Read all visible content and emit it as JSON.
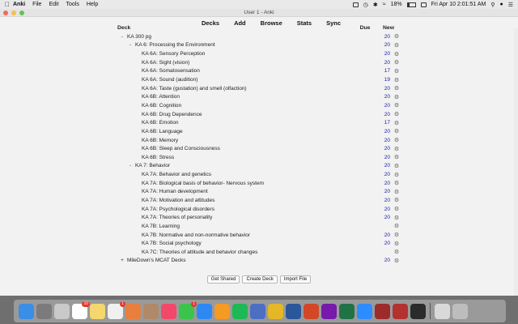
{
  "menubar": {
    "app_name": "Anki",
    "items": [
      "File",
      "Edit",
      "Tools",
      "Help"
    ],
    "battery": "18%",
    "clock": "Fri Apr 10  2:01:51 AM"
  },
  "window": {
    "title": "User 1 - Anki"
  },
  "toolbar": {
    "decks": "Decks",
    "add": "Add",
    "browse": "Browse",
    "stats": "Stats",
    "sync": "Sync"
  },
  "deck_list": {
    "headers": {
      "deck": "Deck",
      "due": "Due",
      "new": "New"
    },
    "rows": [
      {
        "level": 0,
        "expander": "-",
        "name": "KA 300 pg",
        "new": "20"
      },
      {
        "level": 1,
        "expander": "-",
        "name": "KA 6: Processing the Environment",
        "new": "20"
      },
      {
        "level": 2,
        "expander": "",
        "name": "KA 6A: Sensory Perception",
        "new": "20"
      },
      {
        "level": 2,
        "expander": "",
        "name": "KA 6A: Sight (vision)",
        "new": "20"
      },
      {
        "level": 2,
        "expander": "",
        "name": "KA 6A: Somatosensation",
        "new": "17"
      },
      {
        "level": 2,
        "expander": "",
        "name": "KA 6A: Sound (audition)",
        "new": "19"
      },
      {
        "level": 2,
        "expander": "",
        "name": "KA 6A: Taste (gustation) and smell (olfaction)",
        "new": "20"
      },
      {
        "level": 2,
        "expander": "",
        "name": "KA 6B: Attention",
        "new": "20"
      },
      {
        "level": 2,
        "expander": "",
        "name": "KA 6B: Cognition",
        "new": "20"
      },
      {
        "level": 2,
        "expander": "",
        "name": "KA 6B: Drug Dependence",
        "new": "20"
      },
      {
        "level": 2,
        "expander": "",
        "name": "KA 6B: Emotion",
        "new": "17"
      },
      {
        "level": 2,
        "expander": "",
        "name": "KA 6B: Language",
        "new": "20"
      },
      {
        "level": 2,
        "expander": "",
        "name": "KA 6B: Memory",
        "new": "20"
      },
      {
        "level": 2,
        "expander": "",
        "name": "KA 6B: Sleep and Consciousness",
        "new": "20"
      },
      {
        "level": 2,
        "expander": "",
        "name": "KA 6B: Stress",
        "new": "20"
      },
      {
        "level": 1,
        "expander": "-",
        "name": "KA 7: Behavior",
        "new": "20"
      },
      {
        "level": 2,
        "expander": "",
        "name": "KA 7A: Behavior and genetics",
        "new": "20"
      },
      {
        "level": 2,
        "expander": "",
        "name": "KA 7A: Biological basis of behavior- Nervous system",
        "new": "20"
      },
      {
        "level": 2,
        "expander": "",
        "name": "KA 7A: Human development",
        "new": "20"
      },
      {
        "level": 2,
        "expander": "",
        "name": "KA 7A: Motivation and attitudes",
        "new": "20"
      },
      {
        "level": 2,
        "expander": "",
        "name": "KA 7A: Psychological disorders",
        "new": "20"
      },
      {
        "level": 2,
        "expander": "",
        "name": "KA 7A: Theories of personality",
        "new": "20"
      },
      {
        "level": 2,
        "expander": "",
        "name": "KA 7B: Learning",
        "new": ""
      },
      {
        "level": 2,
        "expander": "",
        "name": "KA 7B: Normative and non-normative behavior",
        "new": "20"
      },
      {
        "level": 2,
        "expander": "",
        "name": "KA 7B: Social psychology",
        "new": "20"
      },
      {
        "level": 2,
        "expander": "",
        "name": "KA 7C: Theories of attitude and behavior changes",
        "new": ""
      },
      {
        "level": 0,
        "expander": "+",
        "name": "MileDown's MCAT Decks",
        "new": "20"
      }
    ]
  },
  "bottom_buttons": {
    "get_shared": "Get Shared",
    "create_deck": "Create Deck",
    "import_file": "Import File"
  },
  "dock": {
    "apps": [
      {
        "name": "finder-icon",
        "color": "#3a8ee6"
      },
      {
        "name": "system-preferences-icon",
        "color": "#7b7b7b"
      },
      {
        "name": "launchpad-icon",
        "color": "#c9c9c9"
      },
      {
        "name": "calendar-icon",
        "color": "#ffffff",
        "badge": "10"
      },
      {
        "name": "notes-icon",
        "color": "#f5d76e"
      },
      {
        "name": "reminders-icon",
        "color": "#f0f0f0",
        "badge": "1"
      },
      {
        "name": "photos-icon",
        "color": "#e87f3c"
      },
      {
        "name": "contacts-icon",
        "color": "#b08968"
      },
      {
        "name": "music-icon",
        "color": "#f2496b"
      },
      {
        "name": "messages-icon",
        "color": "#3bc44b",
        "badge": "1"
      },
      {
        "name": "app-store-icon",
        "color": "#2d88f3"
      },
      {
        "name": "books-icon",
        "color": "#f59a23"
      },
      {
        "name": "spotify-icon",
        "color": "#1db954"
      },
      {
        "name": "anki-icon",
        "color": "#4c6fc2"
      },
      {
        "name": "chrome-icon",
        "color": "#e3b726"
      },
      {
        "name": "word-icon",
        "color": "#2b579a"
      },
      {
        "name": "powerpoint-icon",
        "color": "#d24726"
      },
      {
        "name": "onenote-icon",
        "color": "#7719aa"
      },
      {
        "name": "excel-icon",
        "color": "#217346"
      },
      {
        "name": "zoom-icon",
        "color": "#2d8cff"
      },
      {
        "name": "dictionary-icon",
        "color": "#9c2b2b"
      },
      {
        "name": "photo-booth-icon",
        "color": "#b3312e"
      },
      {
        "name": "terminal-icon",
        "color": "#2b2b2b"
      },
      {
        "name": "downloads-icon",
        "color": "#d9d9d9"
      },
      {
        "name": "trash-icon",
        "color": "#bdbdbd"
      }
    ]
  }
}
